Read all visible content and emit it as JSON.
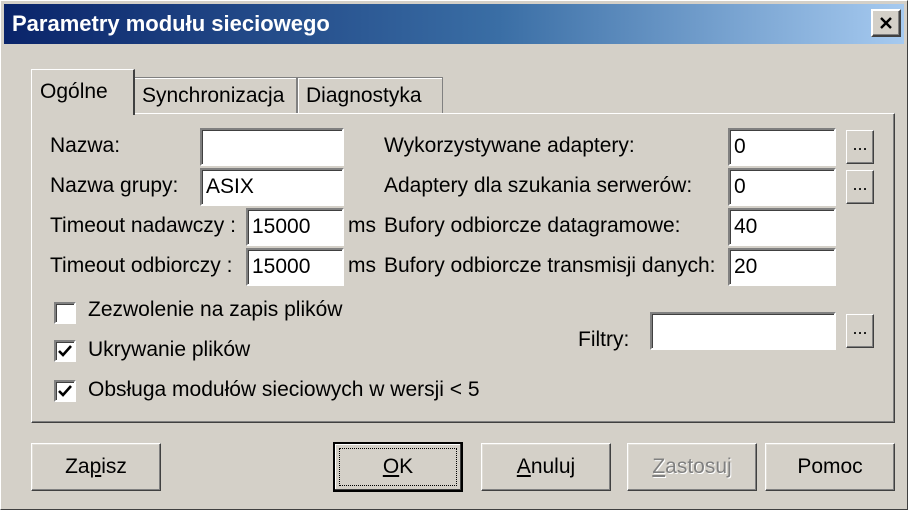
{
  "window": {
    "title": "Parametry modułu sieciowego"
  },
  "tabs": [
    {
      "label": "Ogólne",
      "active": true
    },
    {
      "label": "Synchronizacja",
      "active": false
    },
    {
      "label": "Diagnostyka",
      "active": false
    }
  ],
  "general": {
    "name_label": "Nazwa:",
    "name_value": "",
    "group_label": "Nazwa grupy:",
    "group_value": "ASIX",
    "timeout_send_label": "Timeout nadawczy :",
    "timeout_send_value": "15000",
    "timeout_send_unit": "ms",
    "timeout_recv_label": "Timeout odbiorczy :",
    "timeout_recv_value": "15000",
    "timeout_recv_unit": "ms",
    "adapters_used_label": "Wykorzystywane adaptery:",
    "adapters_used_value": "0",
    "adapters_search_label": "Adaptery dla szukania serwerów:",
    "adapters_search_value": "0",
    "dgram_buffers_label": "Bufory odbiorcze datagramowe:",
    "dgram_buffers_value": "40",
    "transfer_buffers_label": "Bufory odbiorcze transmisji danych:",
    "transfer_buffers_value": "20",
    "filters_label": "Filtry:",
    "filters_value": "",
    "browse_label": "...",
    "checkboxes": [
      {
        "label": "Zezwolenie na zapis plików",
        "checked": false
      },
      {
        "label": "Ukrywanie plików",
        "checked": true
      },
      {
        "label": "Obsługa modułów sieciowych w wersji < 5",
        "checked": true
      }
    ]
  },
  "buttons": {
    "save_pre": "Za",
    "save_key": "p",
    "save_post": "isz",
    "ok_key": "O",
    "ok_post": "K",
    "cancel_key": "A",
    "cancel_post": "nuluj",
    "apply_key": "Z",
    "apply_post": "astosuj",
    "apply_disabled": true,
    "help": "Pomoc"
  }
}
